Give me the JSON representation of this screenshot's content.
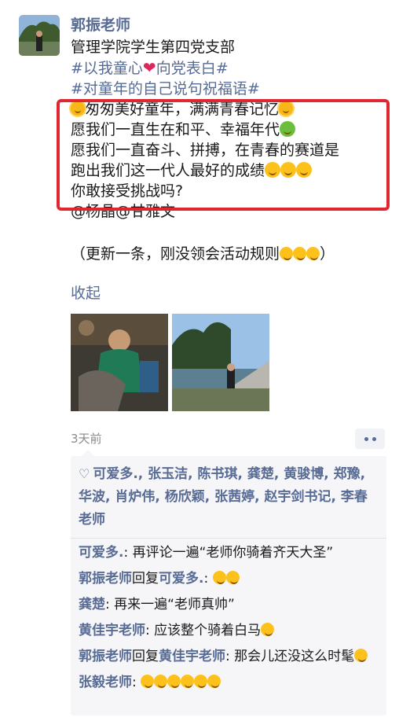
{
  "post": {
    "author": "郭振老师",
    "lines": {
      "org": "管理学院学生第四党支部",
      "tag1_a": "#以我童心",
      "tag1_b": "向党表白#",
      "tag2": "#对童年的自己说句祝福语#",
      "box1": "匆匆美好童年，满满青春记忆",
      "box2": "愿我们一直生在和平、幸福年代",
      "box3": "愿我们一直奋斗、拼搏，在青春的赛道是",
      "box4": "跑出我们这一代人最好的成绩",
      "box5": "你敢接受挑战吗?",
      "mentions": "@杨晶@甘雅文",
      "update": "（更新一条，刚没领会活动规则"
    },
    "collapse_label": "收起",
    "time": "3天前"
  },
  "likes": {
    "names": "可爱多., 张玉洁, 陈书琪, 龚楚, 黄骏博, 郑豫, 华波, 肖炉伟, 杨欣颖, 张茜婷, 赵宇剑书记, 李春老师"
  },
  "comments": [
    {
      "name": "可爱多.",
      "reply_label": "",
      "reply_to": "",
      "text": ": 再评论一遍“老师你骑着齐天大圣”"
    },
    {
      "name": "郭振老师",
      "reply_label": "回复",
      "reply_to": "可爱多.",
      "text": ": "
    },
    {
      "name": "龚楚",
      "reply_label": "",
      "reply_to": "",
      "text": ": 再来一遍“老师真帅”"
    },
    {
      "name": "黄佳宇老师",
      "reply_label": "",
      "reply_to": "",
      "text": ": 应该整个骑着白马"
    },
    {
      "name": "郭振老师",
      "reply_label": "回复",
      "reply_to": "黄佳宇老师",
      "text": ": 那会儿还没这么时髦"
    },
    {
      "name": "张毅老师",
      "reply_label": "",
      "reply_to": "",
      "text": ": "
    }
  ],
  "colors": {
    "link": "#576b95",
    "highlight_box": "#e0262f",
    "panel": "#f6f6f8"
  }
}
